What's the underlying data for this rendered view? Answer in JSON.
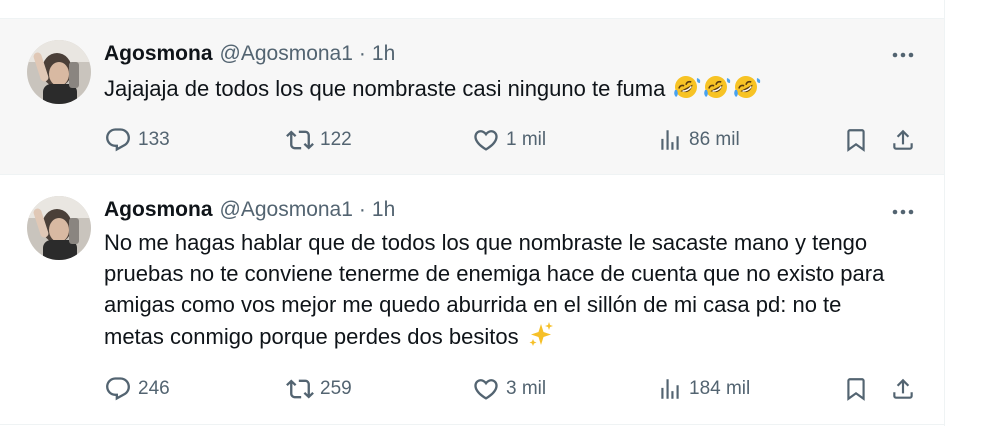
{
  "tweets": [
    {
      "name": "Agosmona",
      "handle": "@Agosmona1",
      "separator": "·",
      "time": "1h",
      "text": "Jajajaja de todos los que nombraste casi ninguno te fuma",
      "emoji": "rolling-on-floor-laughing x3",
      "replies": "133",
      "reposts": "122",
      "likes": "1 mil",
      "views": "86 mil"
    },
    {
      "name": "Agosmona",
      "handle": "@Agosmona1",
      "separator": "·",
      "time": "1h",
      "text": "No me hagas hablar que de todos los que nombraste le sacaste mano y tengo pruebas no te conviene tenerme de enemiga hace de cuenta que no existo para amigas como vos mejor me quedo aburrida en el sillón de mi casa pd: no te metas conmigo porque perdes dos besitos",
      "emoji": "sparkles",
      "replies": "246",
      "reposts": "259",
      "likes": "3 mil",
      "views": "184 mil"
    }
  ],
  "icons": {
    "reply": "reply-icon",
    "repost": "repost-icon",
    "like": "heart-icon",
    "views": "analytics-icon",
    "bookmark": "bookmark-icon",
    "share": "share-icon",
    "more": "more-icon"
  },
  "colors": {
    "text": "#0f1419",
    "secondary": "#536471",
    "highlight_bg": "#f7f7f7",
    "border": "#eff3f4"
  }
}
